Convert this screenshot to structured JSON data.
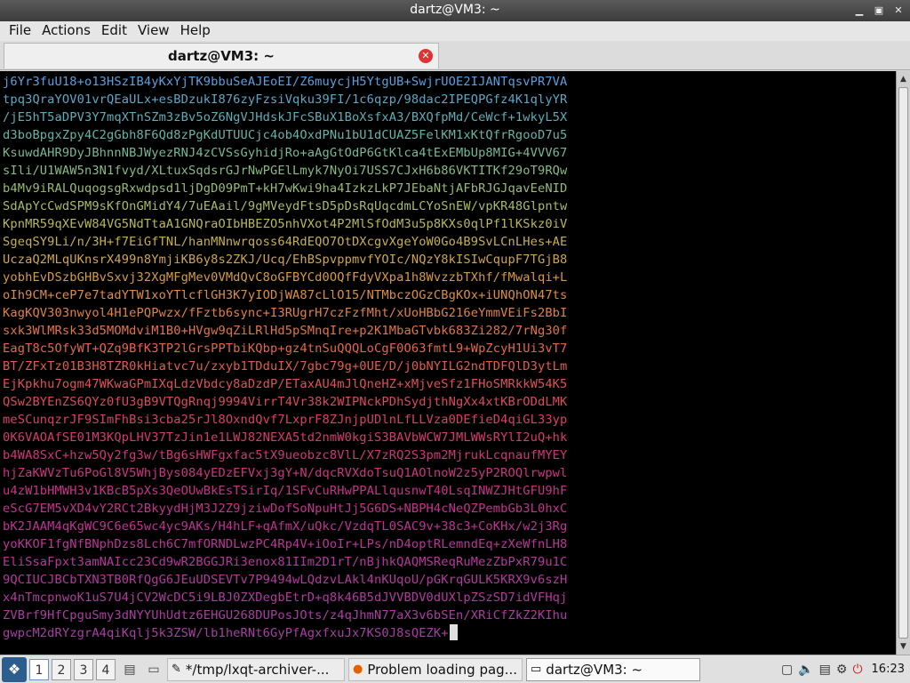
{
  "window": {
    "title": "dartz@VM3: ~",
    "controls": [
      "minimize-icon",
      "maximize-icon",
      "close-icon"
    ]
  },
  "menubar": [
    "File",
    "Actions",
    "Edit",
    "View",
    "Help"
  ],
  "tab": {
    "label": "dartz@VM3: ~",
    "close_icon": "close-icon"
  },
  "terminal_lines": [
    {
      "text": "j6Yr3fuU18+o13HSzIB4yKxYjTK9bbuSeAJEoEI/Z6muycjH5YtgUB+SwjrUOE2IJANTqsvPR7VA",
      "color": "#5aa0e0"
    },
    {
      "text": "tpq3QraYOV01vrQEaULx+esBDzukI876zyFzsiVqku39FI/1c6qzp/98dac2IPEQPGfz4K1qlyYR",
      "color": "#5aa8c8"
    },
    {
      "text": "/jE5hT5aDPV3Y7mqXTnSZm3zBv5oZ6NgVJHdskJFcSBuX1BoXsfxA3/BXQfpMd/CeWcf+1wkyL5X",
      "color": "#5caeb8"
    },
    {
      "text": "d3boBpgxZpy4C2gGbh8F6Qd8zPgKdUTUUCjc4ob4OxdPNu1bU1dCUAZ5FelKM1xKtQfrRgooD7u5",
      "color": "#66b4a6"
    },
    {
      "text": "KsuwdAHR9DyJBhnnNBJWyezRNJ4zCVSsGyhidjRo+aAgGtOdP6GtKlca4tExEMbUp8MIG+4VVV67",
      "color": "#76b896"
    },
    {
      "text": "sIli/U1WAW5n3N1fvyd/XLtuxSqdsrGJrNwPGElLmyk7NyOi7USS7CJxH6b86VKTITKf29oT9RQw",
      "color": "#86bb86"
    },
    {
      "text": "b4Mv9iRALQuqogsgRxwdpsd1ljDgD09PmT+kH7wKwi9ha4IzkzLkP7JEbaNtjAFbRJGJqavEeNID",
      "color": "#98bc74"
    },
    {
      "text": "SdApYcCwdSPM9sKfOnGMidY4/7uEAail/9gMVeydFtsD5pDsRqUqcdmLCYoSnEW/vpKR48Glpntw",
      "color": "#a8bb66"
    },
    {
      "text": "KpnMR59qXEvW84VG5NdTtaA1GNQraOIbHBEZO5nhVXot4P2MlSfOdM3u5p8KXs0qlPf1lKSkz0iV",
      "color": "#b8b858"
    },
    {
      "text": "SgeqSY9Li/n/3H+f7EiGfTNL/hanMNnwrqoss64RdEQO7OtDXcgvXgeYoW0Go4B9SvLCnLHes+AE",
      "color": "#c6b04e"
    },
    {
      "text": "UczaQ2MLqUKnsrX499n8YmjiKB6y8s2ZKJ/Ucq/EhBSpvppmvfYOIc/NQzY8kISIwCqupF7TGjB8",
      "color": "#d0a648"
    },
    {
      "text": "yobhEvDSzbGHBvSxvj32XgMFgMev0VMdQvC8oGFBYCd0OQfFdyVXpa1h8WvzzbTXhf/fMwalqi+L",
      "color": "#d89a44"
    },
    {
      "text": "oIh9CM+ceP7e7tadYTW1xoYTlcflGH3K7yIODjWA87cLlO15/NTMbczOGzCBgKOx+iUNQhON47ts",
      "color": "#de8e42"
    },
    {
      "text": "KagKQV303nwyol4H1ePQPwzx/fFztb6sync+I3RUgrH7czFzfMht/xUoHBbG216eYmmVEiFs2BbI",
      "color": "#e28042"
    },
    {
      "text": "sxk3WlMRsk33d5MOMdviM1B0+HVgw9qZiLRlHd5pSMnqIre+p2K1MbaGTvbk683Zi282/7rNg30f",
      "color": "#e47444"
    },
    {
      "text": "EagT8c5OfyWT+QZq9BfK3TP2lGrsPPTbiKQbp+gz4tnSuQQQLoCgF0O63fmtL9+WpZcyH1Ui3vT7",
      "color": "#e46848"
    },
    {
      "text": "BT/ZFxTz01B3H8TZR0kHiatvc7u/zxyb1TDduIX/7gbc79g+0UE/D/j0bNYILG2ndTDFQlD3ytLm",
      "color": "#e25c4e"
    },
    {
      "text": "EjKpkhu7ogm47WKwaGPmIXqLdzVbdcy8aDzdP/ETaxAU4mJlQneHZ+xMjveSfz1FHoSMRkkW54K5",
      "color": "#e05256"
    },
    {
      "text": "QSw2BYEnZS6QYz0fU3gB9VTQgRnqj9994VirrT4Vr38k2WIPNckPDhSydjthNgXx4xtKBrODdLMK",
      "color": "#de485e"
    },
    {
      "text": "meSCunqzrJF9SImFhBsi3cba25rJl8OxndQvf7LxprF8ZJnjpUDlnLfLLVza0DEfieD4qiGL33yp",
      "color": "#da4066"
    },
    {
      "text": "0K6VAOAfSE01M3KQpLHV37TzJin1e1LWJ82NEXA5td2nmW0kgiS3BAVbWCW7JMLWWsRYlI2uQ+hk",
      "color": "#d63a70"
    },
    {
      "text": "b4WA8SxC+hzw5Qy2fg3w/tBg6sHWFgxfac5tX9ueobzc8VlL/X7zRQ2S3pm2MjrukLcqnaufMYEY",
      "color": "#d2367a"
    },
    {
      "text": "hjZaKWVzTu6PoGl8V5WhjBys084yEDzEFVxj3gY+N/dqcRVXdoTsuQ1AOlnoW2z5yP2ROQlrwpwl",
      "color": "#ce3482"
    },
    {
      "text": "u4zW1bHMWH3v1KBcB5pXs3QeOUwBkEsTSirIq/1SFvCuRHwPPALlqusnwT40LsqINWZJHtGFU9hF",
      "color": "#ca328a"
    },
    {
      "text": "eScG7EM5vXD4vY2RCt2BkyydHjM3J2Z9jziwDofSoNpuHtJj5G6DS+NBPH4cNeQZPembGb3L0hxC",
      "color": "#c63290"
    },
    {
      "text": "bK2JAAM4qKgWC9C6e65wc4yc9AKs/H4hLF+qAfmX/uQkc/VzdqTL0SAC9v+38c3+CoKHx/w2j3Rg",
      "color": "#c23296"
    },
    {
      "text": "yoKKOF1fgNfBNphDzs8Lch6C7mfORNDLwzPC4Rp4V+iOoIr+LPs/nD4optRLemndEq+zXeWfnLH8",
      "color": "#be349a"
    },
    {
      "text": "EliSsaFpxt3amNAIcc23Cd9wR2BGGJRi3enox81IIm2D1rT/nBjhkQAQMSReqRuMezZbPxR79u1C",
      "color": "#ba369e"
    },
    {
      "text": "9QCIUCJBCbTXN3TB0RfQgG6JEuUDSEVTv7P9494wLQdzvLAkl4nKUqoU/pGKrqGULK5KRX9v6szH",
      "color": "#b638a0"
    },
    {
      "text": "x4nTmcpnwoK1uS7U4jCV2WcDC5i9LBJ0ZXDegbEtrD+q8k46B5dJVVBDV0dUXlpZSzSD7idVFHqj",
      "color": "#b23aa2"
    },
    {
      "text": "ZVBrf9HfCpguSmy3dNYYUhUdtz6EHGU268DUPosJOts/z4qJhmN77aX3v6bSEn/XRiCfZkZ2KIhu",
      "color": "#ae3ca4"
    },
    {
      "text": "gwpcM2dRYzgrA4qiKqlj5k3ZSW/lb1heRNt6GyPfAgxfxuJx7KS0J8sQEZK+",
      "color": "#aa3ea6"
    }
  ],
  "taskbar": {
    "menu_icon": "lxqt-menu-icon",
    "desktops": [
      "1",
      "2",
      "3",
      "4"
    ],
    "quicklaunch": [
      "file-manager-icon",
      "terminal-icon"
    ],
    "tasks": [
      {
        "icon": "text-editor-icon",
        "label": "*/tmp/lxqt-archiver-..."
      },
      {
        "icon": "firefox-icon",
        "label": "Problem loading pag..."
      },
      {
        "icon": "terminal-icon",
        "label": "dartz@VM3: ~"
      }
    ],
    "tray": [
      "clipboard-icon",
      "volume-icon",
      "notes-icon",
      "network-icon",
      "power-icon"
    ],
    "clock": "16:23"
  }
}
